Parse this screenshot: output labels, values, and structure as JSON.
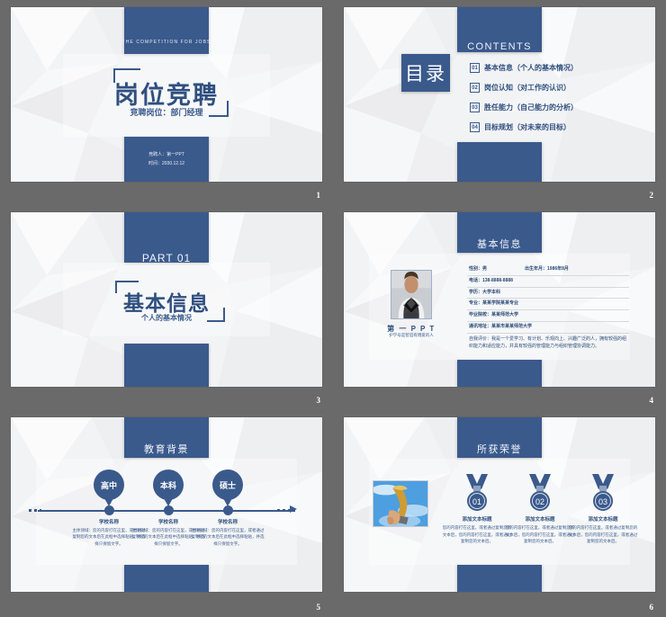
{
  "theme": {
    "accent": "#3a5a8c",
    "accent_text": "#2f4f7f",
    "slide_bg": "#f4f5f7",
    "page_bg": "#6a6a6a"
  },
  "slides": [
    {
      "number": "1",
      "eyebrow": "THE COMPETITION FOR JOBS",
      "title": "岗位竞聘",
      "subtitle": "竞聘岗位：部门经理",
      "meta_line1": "竞聘人：第一PPT",
      "meta_line2": "时间：2030.12.12"
    },
    {
      "number": "2",
      "header": "CONTENTS",
      "badge": "目录",
      "items": [
        {
          "num": "01",
          "label": "基本信息（个人的基本情况）"
        },
        {
          "num": "02",
          "label": "岗位认知（对工作的认识）"
        },
        {
          "num": "03",
          "label": "胜任能力（自己能力的分析）"
        },
        {
          "num": "04",
          "label": "目标规划（对未来的目标）"
        }
      ]
    },
    {
      "number": "3",
      "part": "PART 01",
      "title": "基本信息",
      "subtitle": "个人的基本情况"
    },
    {
      "number": "4",
      "header": "基本信息",
      "photo_name": "第 一 P P T",
      "photo_tag": "护学号是智谊有博爱的人",
      "rows": [
        {
          "left": "性别：男",
          "right": "出生年月：1986年8月"
        },
        {
          "left": "电话：138-8888-8888",
          "right": ""
        },
        {
          "left": "学历：大学本科",
          "right": ""
        },
        {
          "left": "专业：某某学院某某专业",
          "right": ""
        },
        {
          "left": "毕业院校：某某师范大学",
          "right": ""
        },
        {
          "left": "通讯地址：某某市某某师范大学",
          "right": ""
        }
      ],
      "description": "自我评价：我是一个爱学习、有计划、乐观向上、兴趣广泛的人，拥有较强的组织能力和适应能力，并具有较强的管理能力与组织管理协调能力。"
    },
    {
      "number": "5",
      "header": "教育背景",
      "stages": [
        {
          "pin": "高中",
          "heading": "学校名称",
          "body": "主体领域：您的内容打在这里，或者通过复制您的文本后在此框中选择粘贴，并选择只保留文字。"
        },
        {
          "pin": "本科",
          "heading": "学校名称",
          "body": "主体领域：您的内容打在这里，或者通过复制您的文本后在此框中选择粘贴，并选择只保留文字。"
        },
        {
          "pin": "硕士",
          "heading": "学校名称",
          "body": "主体领域：您的内容打在这里，或者通过复制您的文本后在此框中选择粘贴，并选择只保留文字。"
        }
      ]
    },
    {
      "number": "6",
      "header": "所获荣誉",
      "awards": [
        {
          "num": "01",
          "heading": "添加文本标题",
          "body": "您的内容打在这里，或者通过复制您的文本后，您的内容打在这里，或者通过复制您的文本后。"
        },
        {
          "num": "02",
          "heading": "添加文本标题",
          "body": "您的内容打在这里，或者通过复制您的文本后，您的内容打在这里，或者通过复制您的文本后。"
        },
        {
          "num": "03",
          "heading": "添加文本标题",
          "body": "您的内容打在这里，或者通过复制您的文本后，您的内容打在这里，或者通过复制您的文本后。"
        }
      ]
    }
  ]
}
